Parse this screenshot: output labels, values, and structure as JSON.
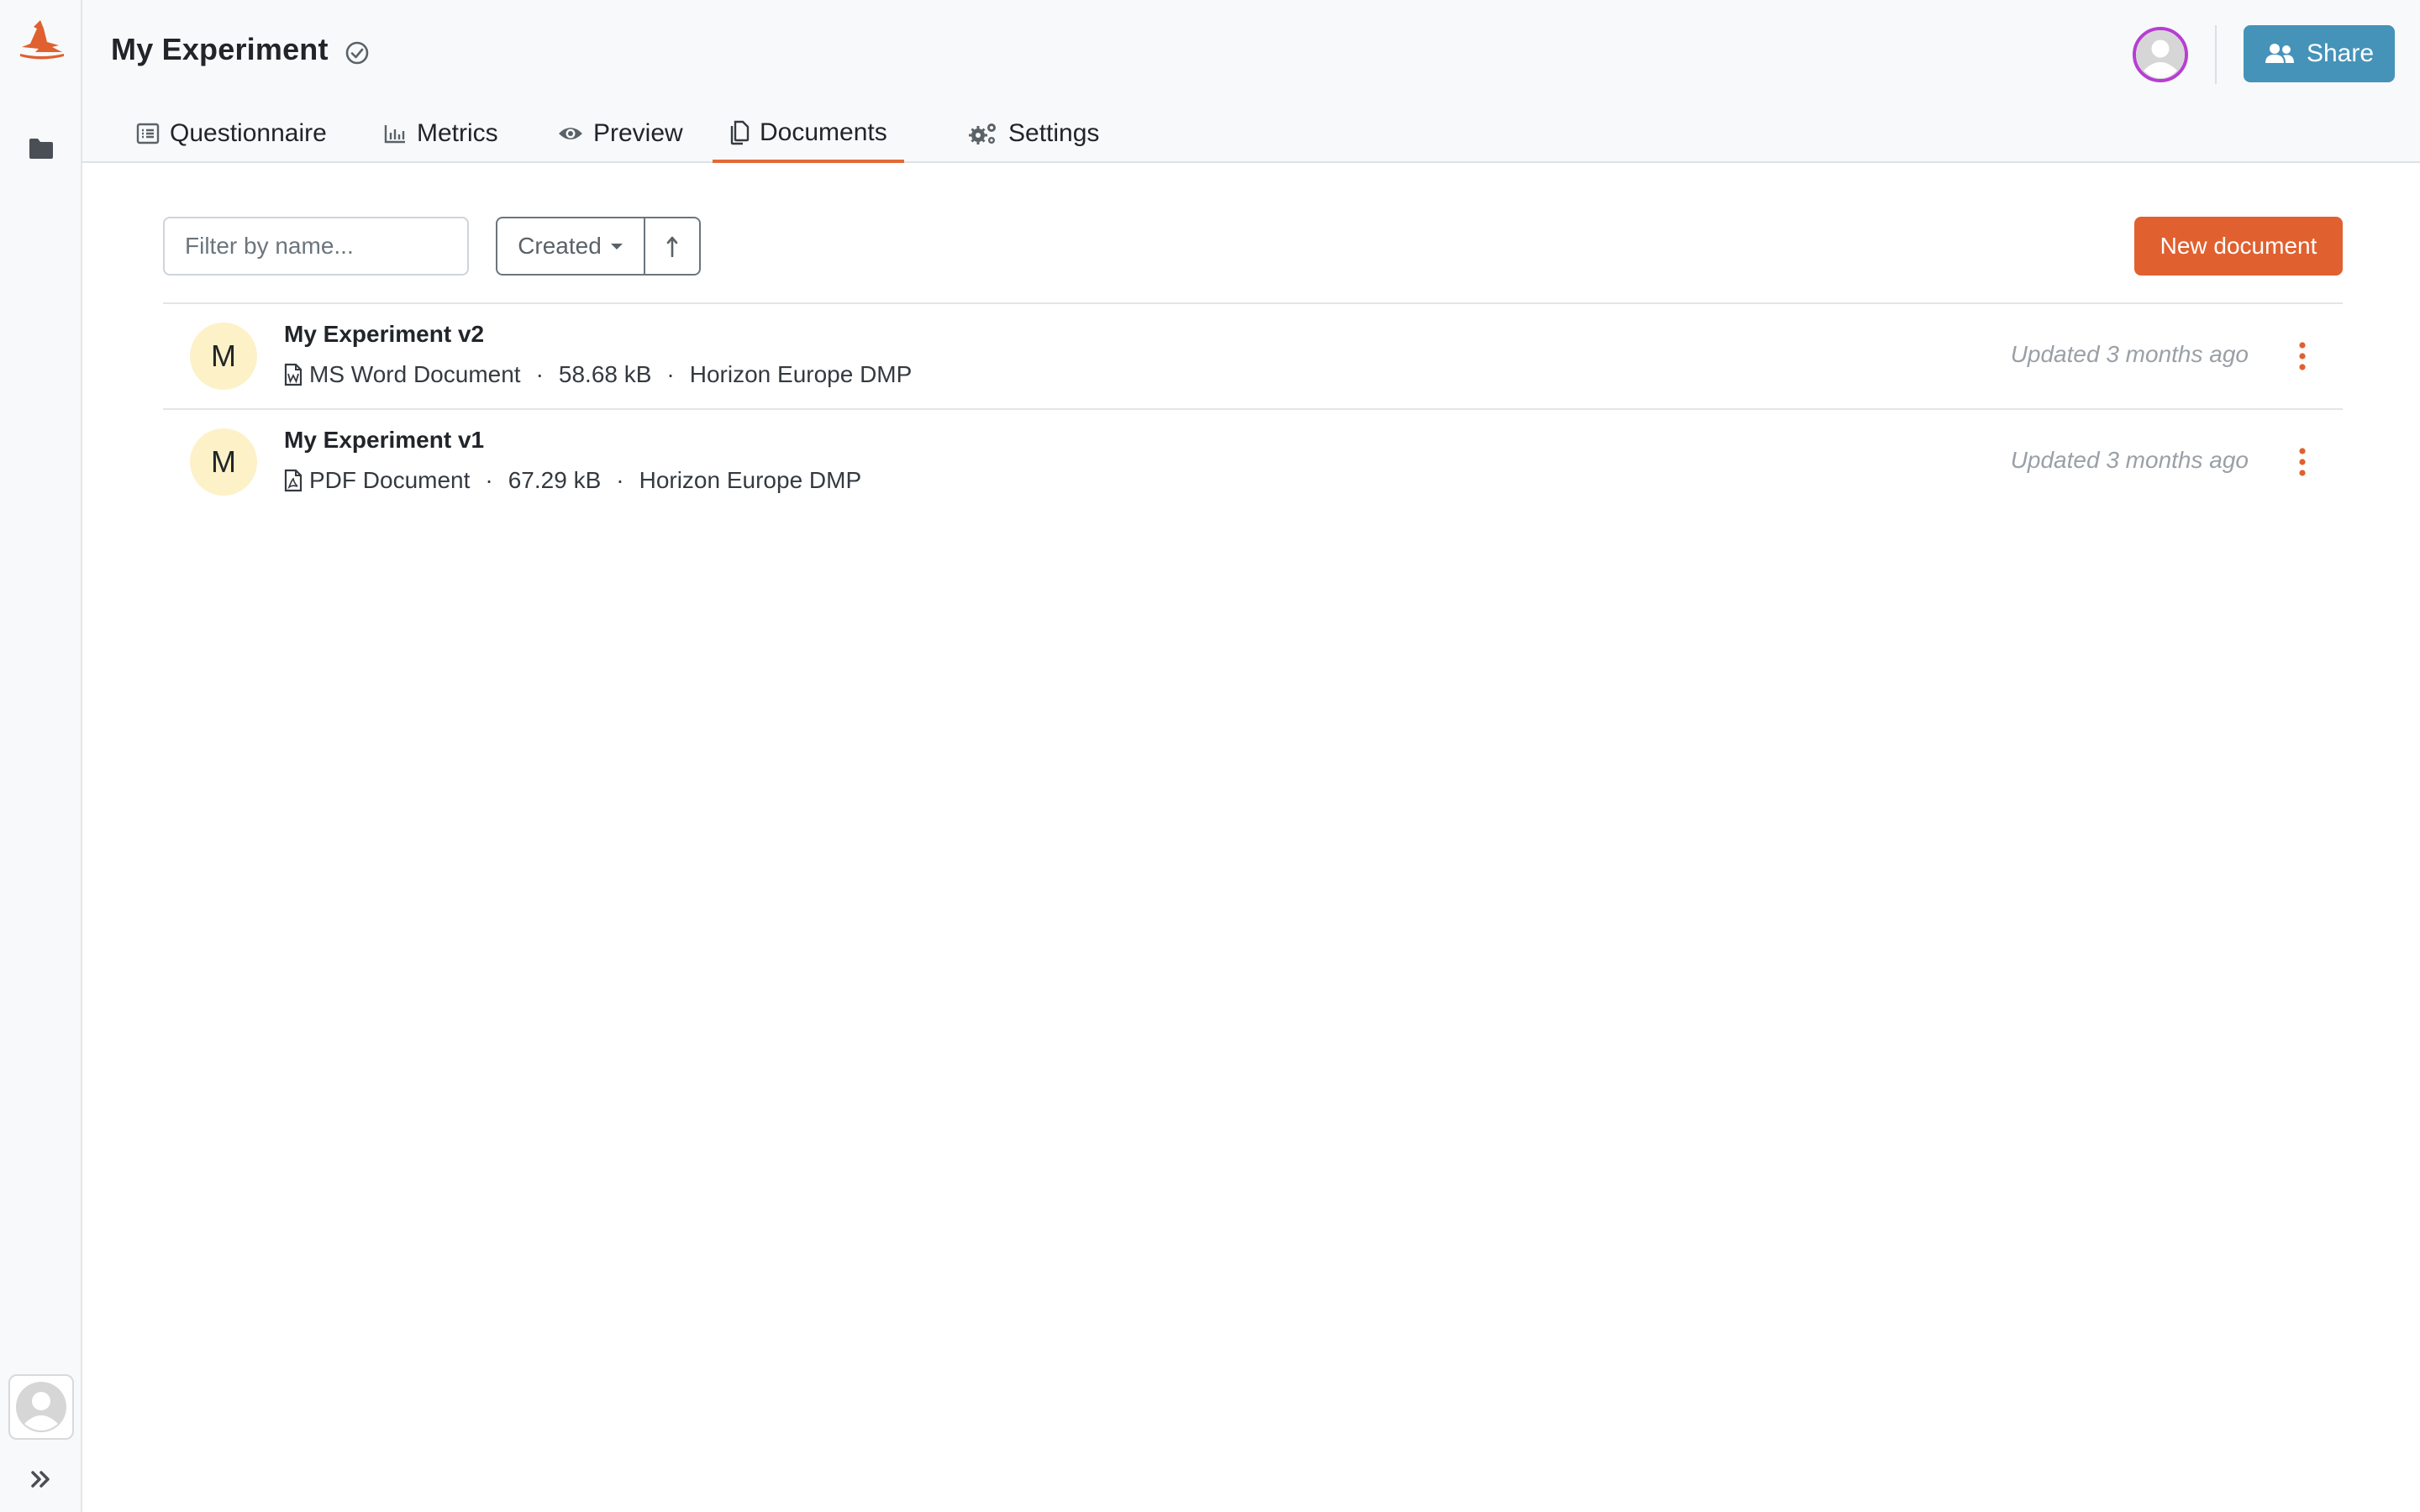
{
  "project": {
    "title": "My Experiment"
  },
  "header": {
    "share_label": "Share"
  },
  "tabs": [
    {
      "label": "Questionnaire",
      "icon": "list-alt-icon"
    },
    {
      "label": "Metrics",
      "icon": "bar-chart-icon"
    },
    {
      "label": "Preview",
      "icon": "eye-icon"
    },
    {
      "label": "Documents",
      "icon": "copy-icon",
      "active": true
    },
    {
      "label": "Settings",
      "icon": "cogs-icon"
    }
  ],
  "toolbar": {
    "filter_placeholder": "Filter by name...",
    "sort_label": "Created",
    "new_document_label": "New document"
  },
  "documents": [
    {
      "avatar": "M",
      "name": "My Experiment v2",
      "format": "MS Word Document",
      "format_icon": "word-file-icon",
      "size": "58.68 kB",
      "template": "Horizon Europe DMP",
      "updated": "Updated 3 months ago"
    },
    {
      "avatar": "M",
      "name": "My Experiment v1",
      "format": "PDF Document",
      "format_icon": "pdf-file-icon",
      "size": "67.29 kB",
      "template": "Horizon Europe DMP",
      "updated": "Updated 3 months ago"
    }
  ],
  "meta_separator": "·",
  "colors": {
    "accent": "#e0602f",
    "share": "#4593b8",
    "avatar_ring": "#b73ed3",
    "avatar_bg": "#fdf1c8"
  }
}
